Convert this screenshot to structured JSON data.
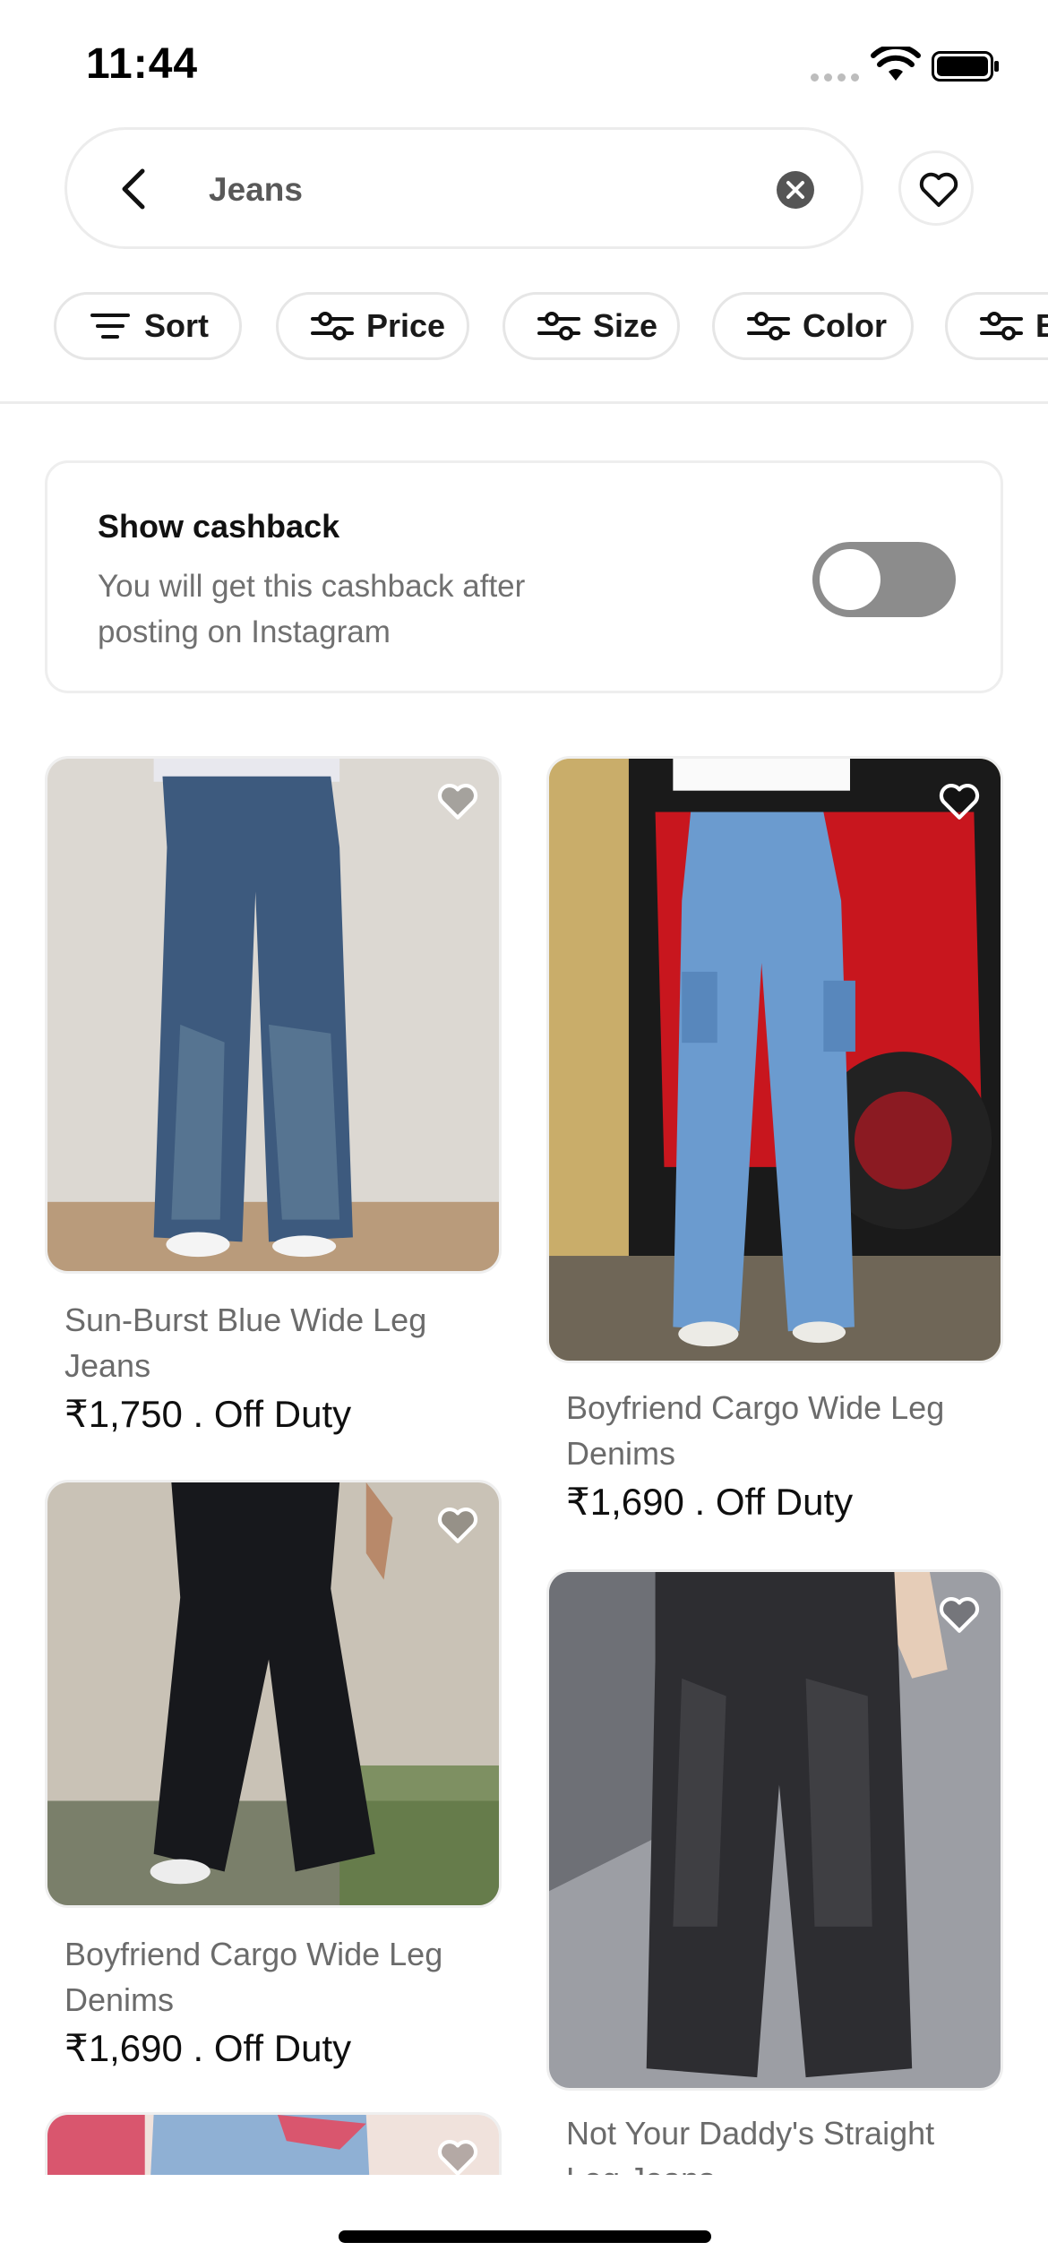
{
  "status_bar": {
    "time": "11:44"
  },
  "search": {
    "query": "Jeans"
  },
  "filters": [
    {
      "label": "Sort",
      "icon": "sort-icon"
    },
    {
      "label": "Price",
      "icon": "sliders-icon"
    },
    {
      "label": "Size",
      "icon": "sliders-icon"
    },
    {
      "label": "Color",
      "icon": "sliders-icon"
    },
    {
      "label": "B",
      "icon": "sliders-icon"
    }
  ],
  "cashback": {
    "title": "Show cashback",
    "description": "You will get this cashback after posting on Instagram",
    "enabled": false
  },
  "products": [
    {
      "name": "Sun-Burst Blue Wide Leg Jeans",
      "price": "₹1,750 . Off Duty",
      "image": "jeans-photo"
    },
    {
      "name": "Boyfriend Cargo Wide Leg Denims",
      "price": "₹1,690 . Off Duty",
      "image": "jeans-photo"
    },
    {
      "name": "Boyfriend Cargo Wide Leg Denims",
      "price": "₹1,690 . Off Duty",
      "image": "jeans-photo"
    },
    {
      "name": "Not Your Daddy's Straight Leg Jeans",
      "price": "",
      "image": "jeans-photo"
    },
    {
      "name": "",
      "price": "",
      "image": "jeans-photo"
    }
  ],
  "colors": {
    "text": "#111111",
    "muted": "#6b6b6b",
    "toggle_off": "#8c8c8c",
    "border": "#ececec"
  }
}
